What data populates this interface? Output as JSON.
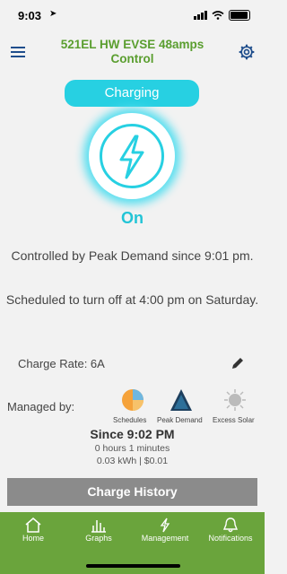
{
  "status": {
    "time": "9:03"
  },
  "header": {
    "title": "521EL HW EVSE 48amps Control"
  },
  "charging_pill": "Charging",
  "charger_state": "On",
  "info": {
    "controlled": "Controlled by Peak Demand since 9:01 pm.",
    "scheduled": "Scheduled to turn off at 4:00 pm on Saturday."
  },
  "charge_rate": "Charge Rate: 6A",
  "managed": {
    "label": "Managed by:",
    "modes": [
      "Schedules",
      "Peak Demand",
      "Excess Solar"
    ]
  },
  "session": {
    "since": "Since 9:02 PM",
    "duration": "0 hours 1 minutes",
    "energy": "0.03 kWh | $0.01"
  },
  "history_button": "Charge History",
  "tabs": [
    "Home",
    "Graphs",
    "Management",
    "Notifications"
  ],
  "colors": {
    "accent": "#27d0e2",
    "brand_green": "#6aa43c",
    "title_green": "#5a9e2f"
  }
}
